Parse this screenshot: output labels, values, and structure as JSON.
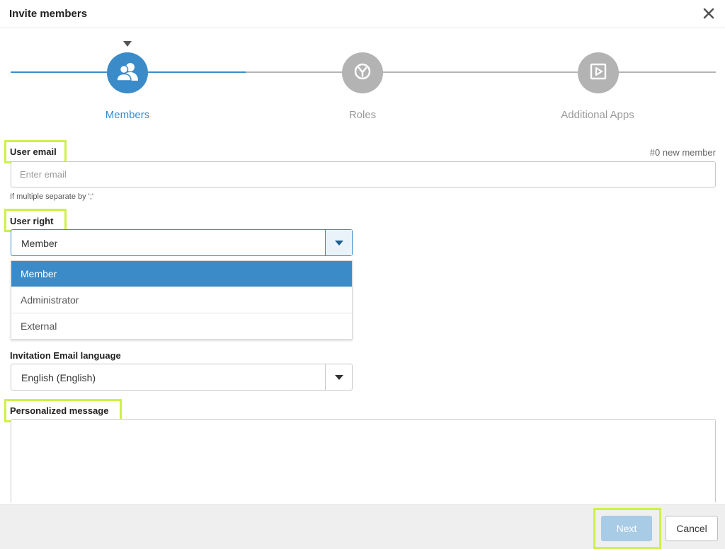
{
  "dialog": {
    "title": "Invite members"
  },
  "stepper": {
    "steps": [
      {
        "label": "Members",
        "icon": "members-icon",
        "state": "active"
      },
      {
        "label": "Roles",
        "icon": "roles-icon",
        "state": "inactive"
      },
      {
        "label": "Additional Apps",
        "icon": "apps-play-icon",
        "state": "inactive"
      }
    ]
  },
  "form": {
    "user_email": {
      "label": "User email",
      "counter": "#0 new member",
      "placeholder": "Enter email",
      "value": "",
      "hint": "If multiple separate by ';'"
    },
    "user_right": {
      "label": "User right",
      "selected": "Member",
      "options": [
        "Member",
        "Administrator",
        "External"
      ],
      "open": true
    },
    "language": {
      "label": "Invitation Email language",
      "selected": "English (English)"
    },
    "message": {
      "label": "Personalized message",
      "value": ""
    }
  },
  "footer": {
    "next_label": "Next",
    "cancel_label": "Cancel"
  },
  "colors": {
    "accent": "#3b8bc9",
    "inactive_step": "#b3b3b3",
    "highlight": "#cdf04a",
    "next_disabled": "#a8cbe6"
  }
}
